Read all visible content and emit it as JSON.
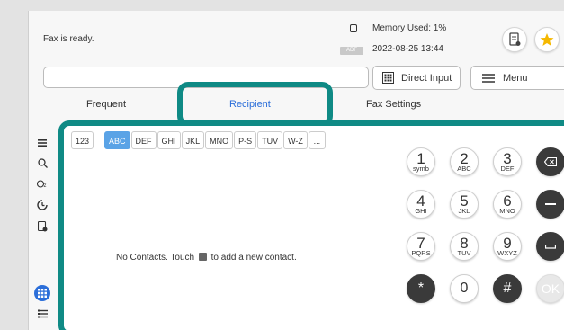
{
  "status": {
    "message": "Fax is ready.",
    "memory": "Memory Used: 1%",
    "date_badge": "ADF",
    "datetime": "2022-08-25 13:44"
  },
  "toolbar": {
    "destination_value": "",
    "direct_input_label": "Direct Input",
    "menu_label": "Menu"
  },
  "tabs": [
    {
      "label": "Frequent"
    },
    {
      "label": "Recipient"
    },
    {
      "label": "Fax Settings"
    }
  ],
  "alpha_index": [
    "123",
    "ABC",
    "DEF",
    "GHI",
    "JKL",
    "MNO",
    "P-S",
    "TUV",
    "W-Z",
    "..."
  ],
  "selected_index": "ABC",
  "contacts": {
    "empty_before": "No Contacts. Touch",
    "empty_after": "to add a new contact."
  },
  "keypad": [
    {
      "digit": "1",
      "letters": "symb"
    },
    {
      "digit": "2",
      "letters": "ABC"
    },
    {
      "digit": "3",
      "letters": "DEF"
    },
    {
      "digit": "4",
      "letters": "GHI"
    },
    {
      "digit": "5",
      "letters": "JKL"
    },
    {
      "digit": "6",
      "letters": "MNO"
    },
    {
      "digit": "7",
      "letters": "PQRS"
    },
    {
      "digit": "8",
      "letters": "TUV"
    },
    {
      "digit": "9",
      "letters": "WXYZ"
    },
    {
      "digit": "*",
      "letters": ""
    },
    {
      "digit": "0",
      "letters": ""
    },
    {
      "digit": "#",
      "letters": ""
    }
  ],
  "ok_label": "OK",
  "colors": {
    "highlight": "#0f8a85",
    "accent": "#2b6ed9",
    "selected_index": "#5aa3e6",
    "star": "#f5b800"
  }
}
